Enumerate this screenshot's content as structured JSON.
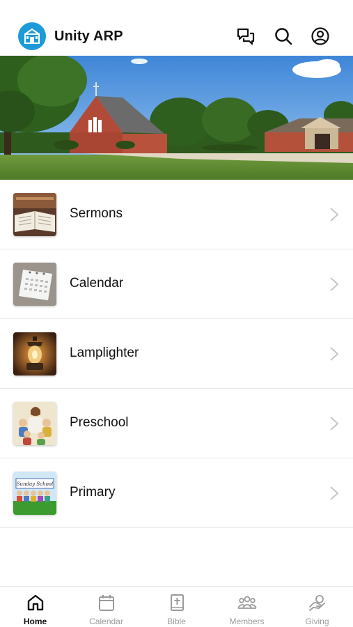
{
  "header": {
    "app_title": "Unity ARP",
    "icons": [
      "chat-bubbles-icon",
      "search-icon",
      "profile-icon"
    ]
  },
  "list": {
    "items": [
      {
        "label": "Sermons",
        "thumb": "open-bible-thumbnail"
      },
      {
        "label": "Calendar",
        "thumb": "calendar-thumbnail"
      },
      {
        "label": "Lamplighter",
        "thumb": "lantern-thumbnail"
      },
      {
        "label": "Preschool",
        "thumb": "children-thumbnail"
      },
      {
        "label": "Primary",
        "thumb": "sunday-school-thumbnail",
        "thumb_text": "Sunday School"
      }
    ]
  },
  "tabbar": {
    "active": "Home",
    "tabs": [
      {
        "label": "Home",
        "icon": "home-icon"
      },
      {
        "label": "Calendar",
        "icon": "calendar-icon"
      },
      {
        "label": "Bible",
        "icon": "bible-icon"
      },
      {
        "label": "Members",
        "icon": "members-icon"
      },
      {
        "label": "Giving",
        "icon": "giving-icon"
      }
    ]
  },
  "colors": {
    "brand": "#1d9bd7",
    "text": "#111111",
    "inactive": "#9a9a9a",
    "divider": "#e8e8e8"
  }
}
